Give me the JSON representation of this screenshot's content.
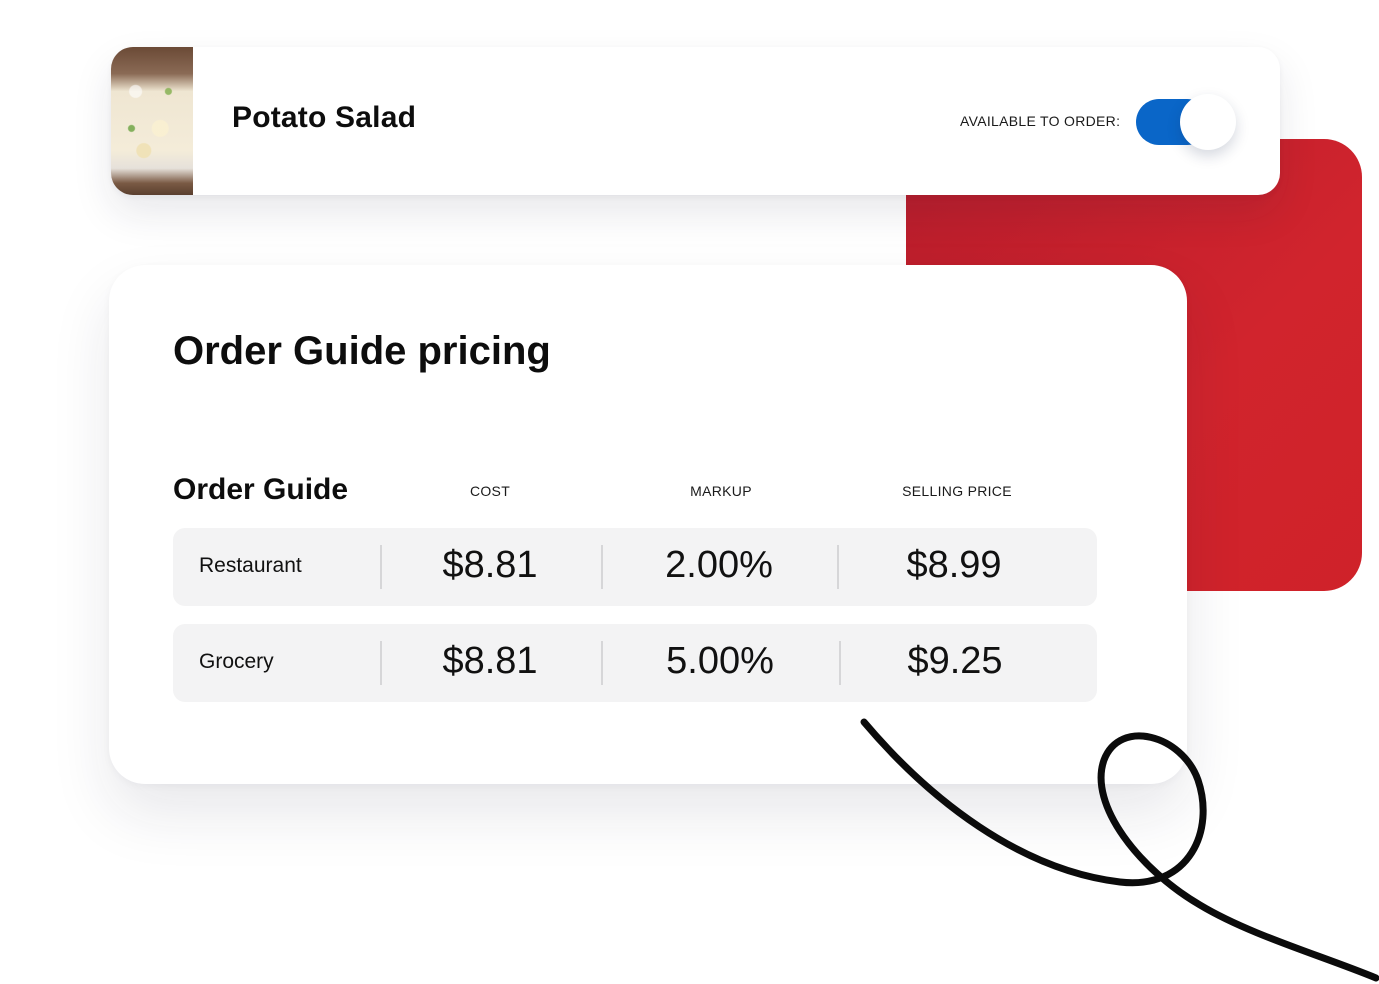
{
  "product": {
    "name": "Potato Salad",
    "availability_label": "AVAILABLE TO ORDER:",
    "available": true
  },
  "pricing": {
    "title": "Order Guide pricing",
    "table_label": "Order Guide",
    "columns": [
      "COST",
      "MARKUP",
      "SELLING PRICE"
    ],
    "rows": [
      {
        "name": "Restaurant",
        "cost": "$8.81",
        "markup": "2.00%",
        "selling_price": "$8.99"
      },
      {
        "name": "Grocery",
        "cost": "$8.81",
        "markup": "5.00%",
        "selling_price": "$9.25"
      }
    ]
  },
  "colors": {
    "accent_red": "#cf2229",
    "toggle_blue": "#0a66c8"
  },
  "icons": {
    "product_thumbnail": "potato-salad-photo"
  }
}
